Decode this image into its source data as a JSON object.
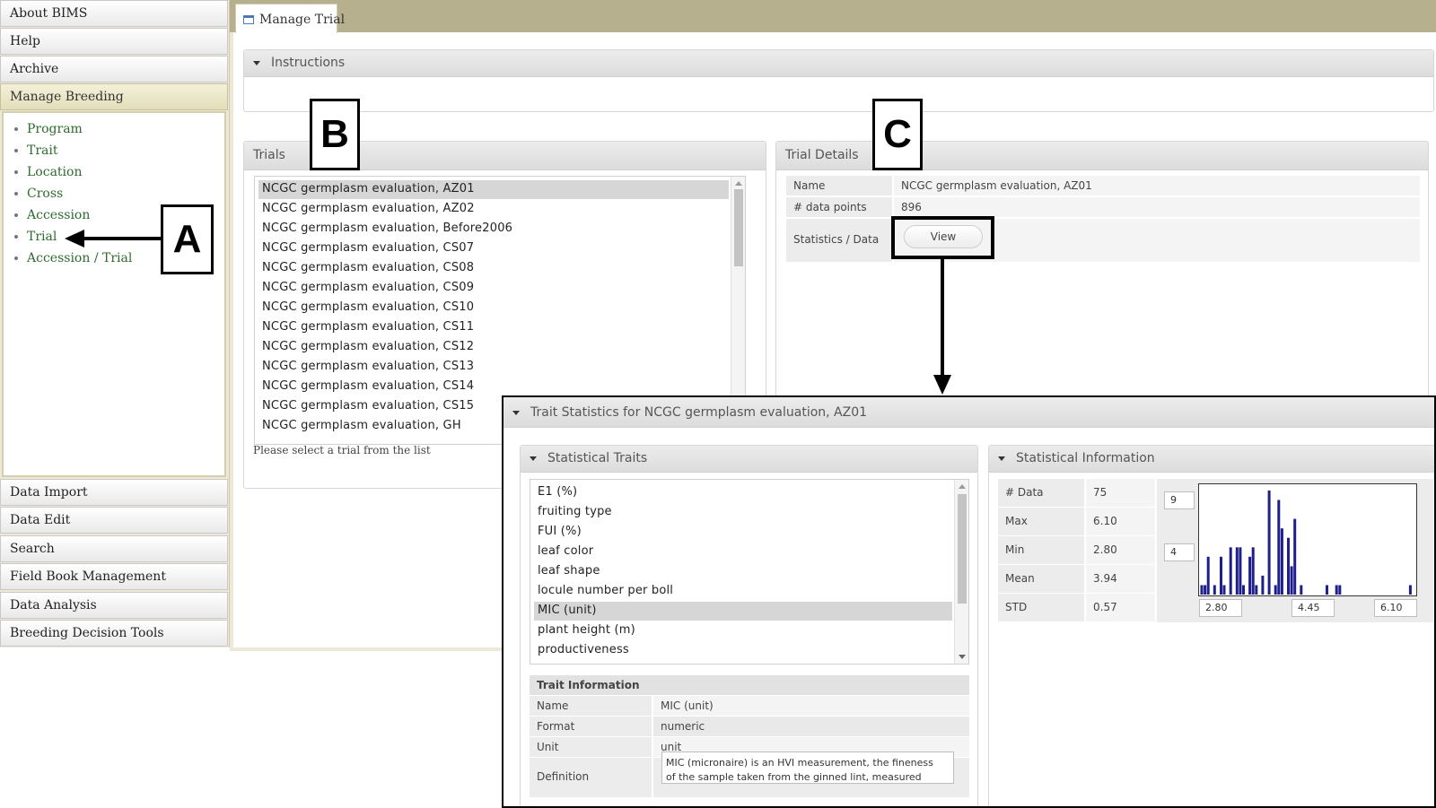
{
  "sidebar": {
    "top_items": [
      {
        "label": "About BIMS"
      },
      {
        "label": "Help"
      },
      {
        "label": "Archive"
      },
      {
        "label": "Manage Breeding"
      }
    ],
    "sub_items": [
      {
        "label": "Program"
      },
      {
        "label": "Trait"
      },
      {
        "label": "Location"
      },
      {
        "label": "Cross"
      },
      {
        "label": "Accession"
      },
      {
        "label": "Trial"
      },
      {
        "label": "Accession / Trial"
      }
    ],
    "bottom_items": [
      {
        "label": "Data Import"
      },
      {
        "label": "Data Edit"
      },
      {
        "label": "Search"
      },
      {
        "label": "Field Book Management"
      },
      {
        "label": "Data Analysis"
      },
      {
        "label": "Breeding Decision Tools"
      }
    ]
  },
  "tab": {
    "label": "Manage Trial"
  },
  "instructions": {
    "title": "Instructions"
  },
  "trials": {
    "title": "Trials",
    "items": [
      "NCGC germplasm evaluation, AZ01",
      "NCGC germplasm evaluation, AZ02",
      "NCGC germplasm evaluation, Before2006",
      "NCGC germplasm evaluation, CS07",
      "NCGC germplasm evaluation, CS08",
      "NCGC germplasm evaluation, CS09",
      "NCGC germplasm evaluation, CS10",
      "NCGC germplasm evaluation, CS11",
      "NCGC germplasm evaluation, CS12",
      "NCGC germplasm evaluation, CS13",
      "NCGC germplasm evaluation, CS14",
      "NCGC germplasm evaluation, CS15",
      "NCGC germplasm evaluation, GH"
    ],
    "selected_index": 0,
    "hint": "Please select a trial from the list"
  },
  "trial_details": {
    "title": "Trial Details",
    "name_label": "Name",
    "name_value": "NCGC germplasm evaluation, AZ01",
    "points_label": "# data points",
    "points_value": "896",
    "stats_label": "Statistics / Data",
    "view_label": "View"
  },
  "annotations": {
    "a": "A",
    "b": "B",
    "c": "C"
  },
  "popup": {
    "title": "Trait Statistics for NCGC germplasm evaluation, AZ01",
    "traits_title": "Statistical Traits",
    "traits": [
      "E1 (%)",
      "fruiting type",
      "FUI (%)",
      "leaf color",
      "leaf shape",
      "locule number per boll",
      "MIC (unit)",
      "plant height (m)",
      "productiveness"
    ],
    "selected_trait_index": 6,
    "trait_info": {
      "title": "Trait Information",
      "rows": [
        {
          "key": "Name",
          "value": "MIC (unit)"
        },
        {
          "key": "Format",
          "value": "numeric"
        },
        {
          "key": "Unit",
          "value": "unit"
        }
      ],
      "definition_label": "Definition",
      "definition_text": "MIC (micronaire) is an HVI measurement, the fineness of the sample taken from the ginned lint, measured by a"
    },
    "stats_title": "Statistical Information",
    "stats": [
      {
        "key": "# Data",
        "value": "75"
      },
      {
        "key": "Max",
        "value": "6.10"
      },
      {
        "key": "Min",
        "value": "2.80"
      },
      {
        "key": "Mean",
        "value": "3.94"
      },
      {
        "key": "STD",
        "value": "0.57"
      }
    ],
    "hist_y_top": "9",
    "hist_y_mid": "4",
    "hist_x_min": "2.80",
    "hist_x_mid": "4.45",
    "hist_x_max": "6.10"
  },
  "chart_data": {
    "type": "bar",
    "xlim": [
      2.8,
      6.1
    ],
    "x": [
      2.8,
      2.85,
      2.9,
      3.0,
      3.1,
      3.15,
      3.25,
      3.35,
      3.4,
      3.45,
      3.55,
      3.6,
      3.65,
      3.75,
      3.85,
      3.95,
      4.0,
      4.05,
      4.15,
      4.2,
      4.25,
      4.35,
      4.75,
      4.9,
      4.95,
      6.05
    ],
    "values": [
      1,
      1,
      4,
      1,
      4,
      1,
      5,
      5,
      5,
      1,
      4,
      5,
      1,
      2,
      11,
      1,
      10,
      7,
      6,
      3,
      8,
      1,
      1,
      1,
      1,
      1
    ],
    "colors": {
      "bar": "#1f1f8c",
      "axis": "#333333"
    }
  }
}
